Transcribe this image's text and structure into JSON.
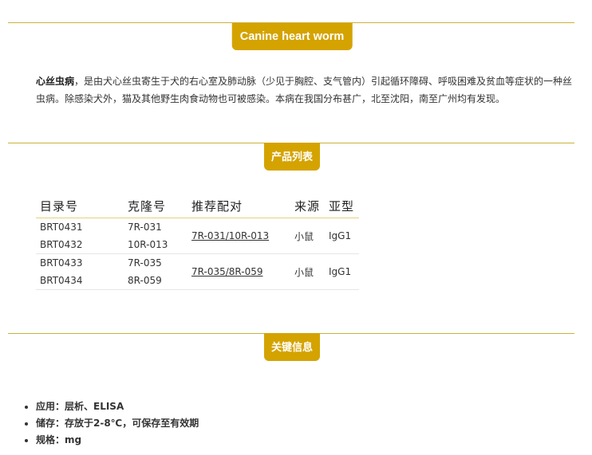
{
  "section1": {
    "tab": "Canine heart worm",
    "intro_bold": "心丝虫病",
    "intro_text": "，是由犬心丝虫寄生于犬的右心室及肺动脉（少见于胸腔、支气管内）引起循环障碍、呼吸困难及贫血等症状的一种丝虫病。除感染犬外，猫及其他野生肉食动物也可被感染。本病在我国分布甚广，北至沈阳，南至广州均有发现。"
  },
  "section2": {
    "tab": "产品列表",
    "headers": [
      "目录号",
      "克隆号",
      "推荐配对",
      "来源",
      "亚型"
    ],
    "groups": [
      {
        "pair": "7R-031/10R-013",
        "source": "小鼠",
        "isotype": "IgG1",
        "rows": [
          {
            "catalog": "BRT0431",
            "clone": "7R-031"
          },
          {
            "catalog": "BRT0432",
            "clone": "10R-013"
          }
        ]
      },
      {
        "pair": "7R-035/8R-059",
        "source": "小鼠",
        "isotype": "IgG1",
        "rows": [
          {
            "catalog": "BRT0433",
            "clone": "7R-035"
          },
          {
            "catalog": "BRT0434",
            "clone": "8R-059"
          }
        ]
      }
    ]
  },
  "section3": {
    "tab": "关键信息",
    "items": [
      "应用：层析、ELISA",
      "储存：存放于2-8℃，可保存至有效期",
      "规格：mg"
    ]
  }
}
